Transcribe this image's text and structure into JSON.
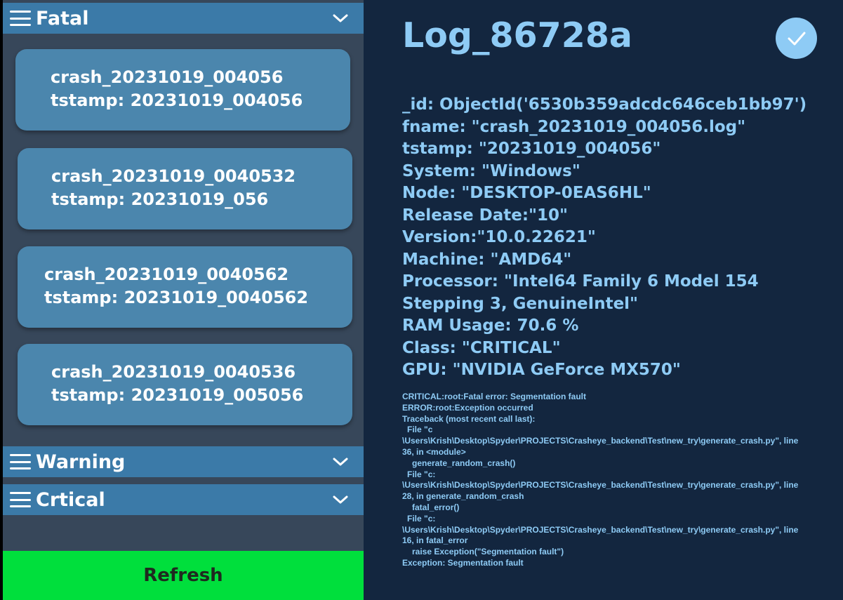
{
  "sections": {
    "fatal": {
      "title": "Fatal"
    },
    "warning": {
      "title": "Warning"
    },
    "critical": {
      "title": "Crtical"
    }
  },
  "cards": [
    {
      "name": "crash_20231019_004056",
      "tstamp": "tstamp: 20231019_004056"
    },
    {
      "name": "crash_20231019_0040532",
      "tstamp": "tstamp: 20231019_056"
    },
    {
      "name": "crash_20231019_0040562",
      "tstamp": "tstamp: 20231019_0040562"
    },
    {
      "name": "crash_20231019_0040536",
      "tstamp": "tstamp: 20231019_005056"
    }
  ],
  "refresh_label": "Refresh",
  "log": {
    "title": "Log_86728a",
    "details": [
      "_id: ObjectId('6530b359adcdc646ceb1bb97')",
      "fname: \"crash_20231019_004056.log\"",
      "tstamp: \"20231019_004056\"",
      "System: \"Windows\"",
      "Node: \"DESKTOP-0EAS6HL\"",
      "Release Date:\"10\"",
      "Version:\"10.0.22621\"",
      "Machine: \"AMD64\"",
      "Processor: \"Intel64 Family 6 Model 154",
      "Stepping 3, GenuineIntel\"",
      "RAM Usage: 70.6 %",
      "Class: \"CRITICAL\"",
      "GPU: \"NVIDIA GeForce MX570\""
    ],
    "traceback": [
      "CRITICAL:root:Fatal error: Segmentation fault",
      "ERROR:root:Exception occurred",
      "Traceback (most recent call last):",
      "  File \"c",
      "\\Users\\Krish\\Desktop\\Spyder\\PROJECTS\\Crasheye_backend\\Test\\new_try\\generate_crash.py\", line",
      "36, in <module>",
      "    generate_random_crash()",
      "  File \"c:",
      "\\Users\\Krish\\Desktop\\Spyder\\PROJECTS\\Crasheye_backend\\Test\\new_try\\generate_crash.py\", line",
      "28, in generate_random_crash",
      "    fatal_error()",
      "  File \"c:",
      "\\Users\\Krish\\Desktop\\Spyder\\PROJECTS\\Crasheye_backend\\Test\\new_try\\generate_crash.py\", line",
      "16, in fatal_error",
      "    raise Exception(\"Segmentation fault\")",
      "Exception: Segmentation fault"
    ]
  },
  "colors": {
    "left_bg": "#37475a",
    "header_bg": "#3b7aa8",
    "card_bg": "#4b86ad",
    "right_bg": "#13263f",
    "accent_text": "#8ecbf5",
    "refresh_bg": "#00df3c"
  },
  "icons": {
    "menu": "hamburger-icon",
    "expand": "chevron-down-icon",
    "confirm": "checkmark-icon"
  }
}
